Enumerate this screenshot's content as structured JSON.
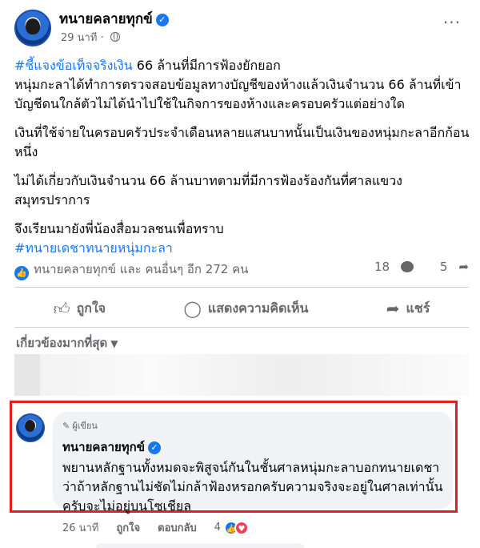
{
  "post": {
    "author": "ทนายคลายทุกข์",
    "time": "29 นาที",
    "paragraphs": [
      {
        "hashtag": "#ชี้แจงข้อเท็จจริงเงิน",
        "text": " 66 ล้านที่มีการฟ้องยักยอก"
      },
      {
        "text": "หนุ่มกะลาได้ทำการตรวจสอบข้อมูลทางบัญชีของห้างแล้วเงินจำนวน 66 ล้านที่เข้าบัญชีดนใกล้ตัวไม่ได้นำไปใช้ในกิจการของห้างและครอบครัวแต่อย่างใด"
      },
      {
        "text": "เงินที่ใช้จ่ายในครอบครัวประจำเดือนหลายแสนบาทนั้นเป็นเงินของหนุ่มกะลาอีกก้อนหนึ่ง"
      },
      {
        "text": "ไม่ได้เกี่ยวกับเงินจำนวน 66 ล้านบาทตามที่มีการฟ้องร้องกันที่ศาลแขวงสมุทรปราการ"
      },
      {
        "text": "จึงเรียนมายังพี่น้องสื่อมวลชนเพื่อทราบ",
        "hashtag2": "#ทนายเดชาทนายหนุ่มกะลา"
      }
    ]
  },
  "reactions": {
    "summary": "ทนายคลายทุกข์ และ คนอื่นๆ อีก 272 คน",
    "comments_count": "18",
    "shares_count": "5"
  },
  "actions": {
    "like": "ถูกใจ",
    "comment": "แสดงความคิดเห็น",
    "share": "แชร์"
  },
  "sort_label": "เกี่ยวข้องมากที่สุด",
  "comment": {
    "badge": "ผู้เขียน",
    "author": "ทนายคลายทุกข์",
    "text": "พยานหลักฐานทั้งหมดจะพิสูจน์กันในชั้นศาลหนุ่มกะลาบอกทนายเดชาว่าถ้าหลักฐานไม่ชัดไม่กล้าฟ้องหรอกครับความจริงจะอยู่ในศาลเท่านั้นครับจะไม่อยู่บนโซเชียล",
    "time": "26 นาที",
    "like": "ถูกใจ",
    "reply": "ตอบกลับ",
    "reaction_count": "4"
  },
  "colors": {
    "link": "#1877f2",
    "highlight": "#e0201f",
    "muted": "#65676b",
    "bubble": "#f0f2f5"
  }
}
